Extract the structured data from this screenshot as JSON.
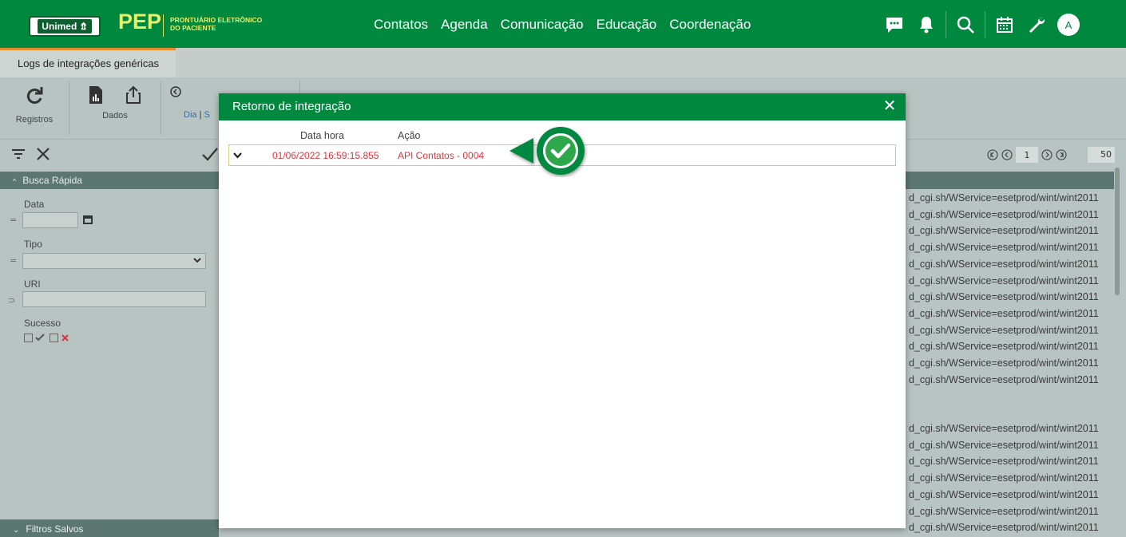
{
  "header": {
    "logo_text": "Unimed",
    "app_name": "PEP",
    "app_subtitle_line1": "PRONTUÁRIO ELETRÔNICO",
    "app_subtitle_line2": "DO PACIENTE",
    "nav": [
      "Contatos",
      "Agenda",
      "Comunicação",
      "Educação",
      "Coordenação"
    ],
    "avatar_letter": "A"
  },
  "tabs": [
    {
      "label": "Logs de integrações genéricas",
      "active": true
    }
  ],
  "toolbar": {
    "registros_label": "Registros",
    "dados_label": "Dados",
    "period_label": "Dia",
    "period_sep": "|",
    "period_next": "S"
  },
  "pager": {
    "current_page": "1",
    "per_page": "50"
  },
  "filters": {
    "quick_search_title": "Busca Rápida",
    "fields": [
      {
        "label": "Data",
        "op": "="
      },
      {
        "label": "Tipo",
        "op": "="
      },
      {
        "label": "URI",
        "op": "⊃"
      },
      {
        "label": "Sucesso"
      }
    ],
    "saved_filters_title": "Filtros Salvos"
  },
  "grid": {
    "uri_fragment": "d_cgi.sh/WService=esetprod/wint/wint2011",
    "visible_rows_group1": 12,
    "visible_rows_group2": 7
  },
  "modal": {
    "title": "Retorno de integração",
    "columns": [
      "Data hora",
      "Ação"
    ],
    "rows": [
      {
        "datetime": "01/06/2022 16:59:15.855",
        "action": "API Contatos - 0004",
        "status": "error"
      }
    ]
  },
  "colors": {
    "primary_green": "#00883f",
    "accent_yellow": "#e6f26b",
    "error_red": "#e0333c",
    "tab_accent": "#e58b2f"
  }
}
